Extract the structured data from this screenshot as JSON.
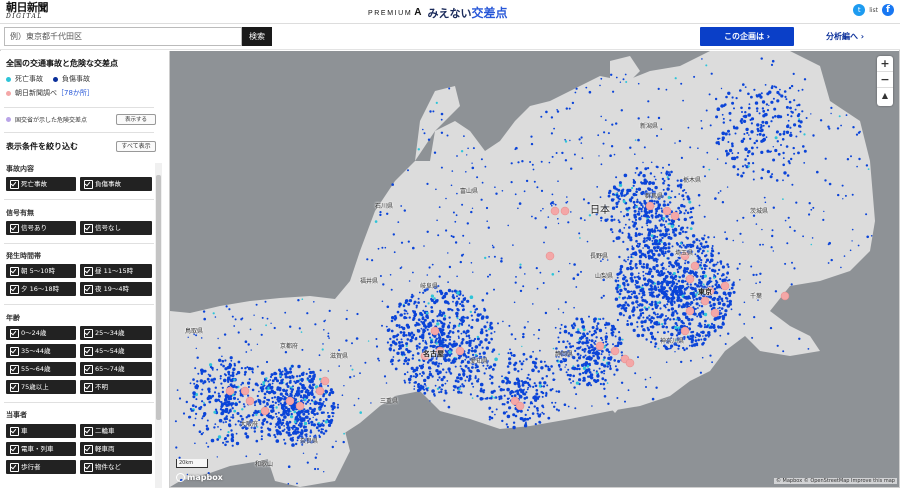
{
  "header": {
    "logo_main": "朝日新聞",
    "logo_sub": "DIGITAL",
    "title_prefix": "PREMIUM",
    "title_prefix_mark": "A",
    "title_main": "みえない",
    "title_accent": "交差点",
    "social_list_label": "list",
    "twitter_icon": "twitter-icon",
    "facebook_icon": "facebook-icon"
  },
  "search": {
    "placeholder": "例）東京都千代田区",
    "value": "",
    "button_label": "検索"
  },
  "nav": {
    "plan_button": "この企画は",
    "analysis_link": "分析編へ"
  },
  "sidebar": {
    "title": "全国の交通事故と危険な交差点",
    "legend": {
      "fatal": "死亡事故",
      "injury": "負傷事故",
      "asahi_survey": "朝日新聞調べ",
      "asahi_count": "［78か所］",
      "mlit": "国交省が示した危険交差点",
      "show_button": "表示する"
    },
    "filter_title": "表示条件を絞り込む",
    "show_all_button": "すべて表示",
    "sections": [
      {
        "label": "事故内容",
        "options": [
          "死亡事故",
          "負傷事故"
        ]
      },
      {
        "label": "信号有無",
        "options": [
          "信号あり",
          "信号なし"
        ]
      },
      {
        "label": "発生時間帯",
        "options": [
          "朝 5〜10時",
          "昼 11〜15時",
          "夕 16〜18時",
          "夜 19〜4時"
        ]
      },
      {
        "label": "年齢",
        "options": [
          "0〜24歳",
          "25〜34歳",
          "35〜44歳",
          "45〜54歳",
          "55〜64歳",
          "65〜74歳",
          "75歳以上",
          "不明"
        ]
      },
      {
        "label": "当事者",
        "options": [
          "車",
          "二輪車",
          "電車・列車",
          "軽車両",
          "歩行者",
          "物件など"
        ]
      }
    ]
  },
  "map": {
    "zoom_in": "+",
    "zoom_out": "−",
    "compass": "▲",
    "scale_label": "20km",
    "brand": "mapbox",
    "attribution": "© Mapbox © OpenStreetMap Improve this map",
    "places": [
      {
        "name": "日本",
        "kind": "big"
      },
      {
        "name": "東京",
        "kind": "city"
      },
      {
        "name": "名古屋",
        "kind": "city"
      },
      {
        "name": "石川県",
        "kind": "pref"
      },
      {
        "name": "富山県",
        "kind": "pref"
      },
      {
        "name": "新潟県",
        "kind": "pref"
      },
      {
        "name": "長野県",
        "kind": "pref"
      },
      {
        "name": "群馬県",
        "kind": "pref"
      },
      {
        "name": "栃木県",
        "kind": "pref"
      },
      {
        "name": "茨城県",
        "kind": "pref"
      },
      {
        "name": "埼玉県",
        "kind": "pref"
      },
      {
        "name": "千葉",
        "kind": "pref"
      },
      {
        "name": "山梨県",
        "kind": "pref"
      },
      {
        "name": "静岡県",
        "kind": "pref"
      },
      {
        "name": "岐阜県",
        "kind": "pref"
      },
      {
        "name": "愛知県",
        "kind": "pref"
      },
      {
        "name": "三重県",
        "kind": "pref"
      },
      {
        "name": "京都府",
        "kind": "pref"
      },
      {
        "name": "大阪府",
        "kind": "pref"
      },
      {
        "name": "奈良県",
        "kind": "pref"
      },
      {
        "name": "和歌山",
        "kind": "pref"
      },
      {
        "name": "福井県",
        "kind": "pref"
      },
      {
        "name": "滋賀県",
        "kind": "pref"
      },
      {
        "name": "鳥取県",
        "kind": "pref"
      },
      {
        "name": "神奈川県",
        "kind": "pref"
      }
    ]
  },
  "colors": {
    "fatal": "#2ec4d8",
    "injury": "#0a3fc8",
    "asahi": "#f4a7a7",
    "mlit": "#b9a4e8",
    "land": "#dcdcdc",
    "sea": "#8e9296",
    "dots": "#0b44d8"
  }
}
